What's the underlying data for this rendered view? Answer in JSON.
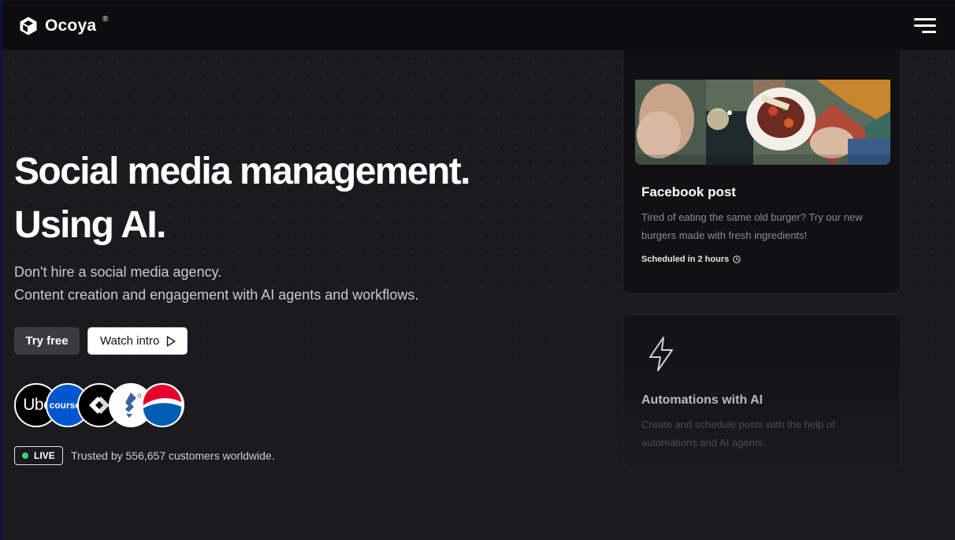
{
  "nav": {
    "brand": "Ocoya",
    "trademark": "®",
    "logo_icon": "cube-icon",
    "menu_icon": "hamburger-menu-icon"
  },
  "hero": {
    "headline_line1": "Social media management.",
    "headline_line2": "Using AI.",
    "sub_line1": "Don't hire a social media agency.",
    "sub_line2": "Content creation and engagement with AI agents and workflows."
  },
  "buttons": {
    "try_free": "Try free",
    "watch_intro": "Watch intro",
    "watch_icon": "play-icon"
  },
  "customer_logos": [
    {
      "name": "uber-logo",
      "text": "Uber"
    },
    {
      "name": "coursera-logo",
      "text": "coursera"
    },
    {
      "name": "x-logo",
      "text": ""
    },
    {
      "name": "toptal-logo",
      "text": ""
    },
    {
      "name": "pepsi-logo",
      "text": ""
    }
  ],
  "social_proof": {
    "live_label": "LIVE",
    "trusted_text": "Trusted by 556,657 customers worldwide."
  },
  "cards": {
    "post_card": {
      "title": "Facebook post",
      "text": "Tired of eating the same old burger? Try our new burgers made with fresh ingredients!",
      "scheduled": "Scheduled in 2 hours",
      "schedule_icon": "clock-icon"
    },
    "automation_card": {
      "icon": "lightning-bolt-icon",
      "title": "Automations with AI",
      "text": "Create and schedule posts with the help of automations and AI agents."
    }
  },
  "colors": {
    "background": "#1b1a1f",
    "nav_background": "#0d0d0f",
    "live_dot": "#37d67a",
    "coursera_blue": "#0056d2"
  }
}
